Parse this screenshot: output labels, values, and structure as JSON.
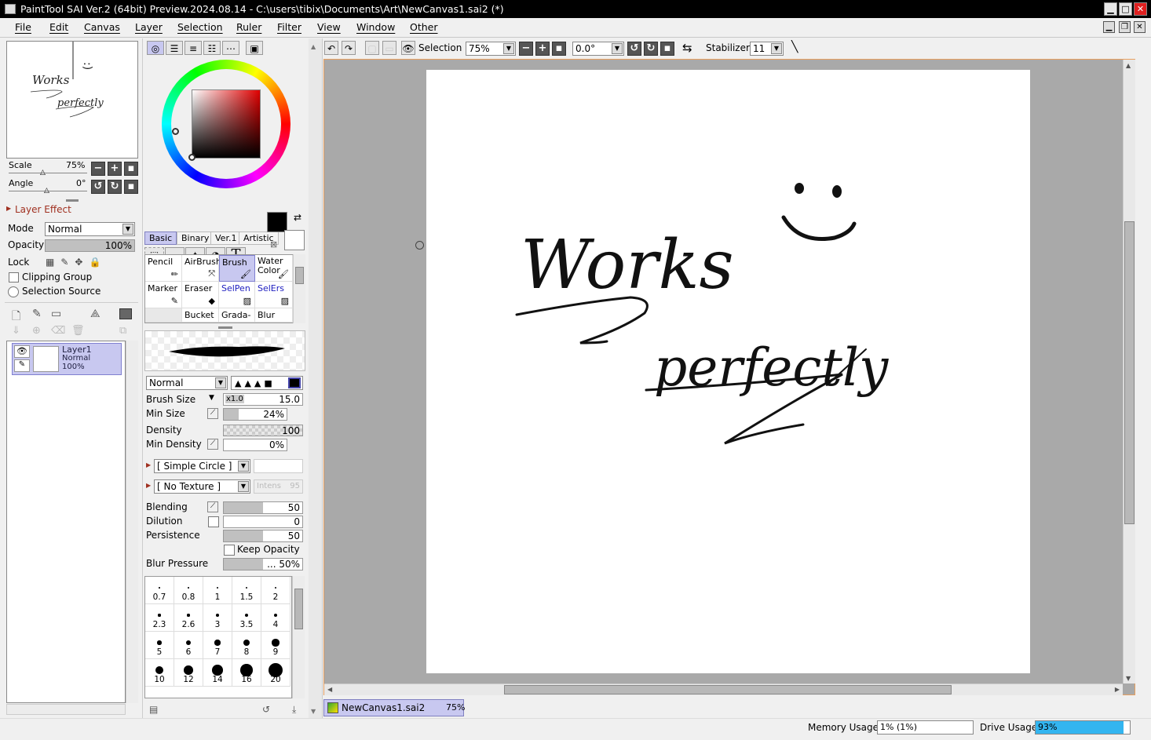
{
  "window": {
    "title": "PaintTool SAI Ver.2 (64bit) Preview.2024.08.14 - C:\\users\\tibix\\Documents\\Art\\NewCanvas1.sai2 (*)",
    "min": "▁",
    "max": "□",
    "close": "✕"
  },
  "menu": [
    "File",
    "Edit",
    "Canvas",
    "Layer",
    "Selection",
    "Ruler",
    "Filter",
    "View",
    "Window",
    "Other"
  ],
  "navigator": {
    "scale_label": "Scale",
    "scale_value": "75%",
    "angle_label": "Angle",
    "angle_value": "0°",
    "preview_text": [
      "Works",
      "perfectly",
      ":)"
    ]
  },
  "layer_effect": {
    "header": "Layer Effect",
    "mode_label": "Mode",
    "mode_value": "Normal",
    "opacity_label": "Opacity",
    "opacity_value": "100%",
    "lock_label": "Lock",
    "clipping_group": "Clipping Group",
    "selection_source": "Selection Source"
  },
  "layers": [
    {
      "name": "Layer1",
      "mode": "Normal",
      "opacity": "100%"
    }
  ],
  "color_tabs": {
    "basic": "Basic",
    "binary": "Binary",
    "ver1": "Ver.1",
    "artistic": "Artistic"
  },
  "tools": [
    {
      "label": "Pencil"
    },
    {
      "label": "AirBrush"
    },
    {
      "label": "Brush",
      "selected": true
    },
    {
      "label": "Water Color"
    },
    {
      "label": "Marker"
    },
    {
      "label": "Eraser"
    },
    {
      "label": "SelPen",
      "blue": true
    },
    {
      "label": "SelErs",
      "blue": true
    },
    {
      "label": ""
    },
    {
      "label": "Bucket"
    },
    {
      "label": "Grada-"
    },
    {
      "label": "Blur"
    }
  ],
  "brush": {
    "blend_mode": "Normal",
    "size_label": "Brush Size",
    "size_mult": "x1.0",
    "size_value": "15.0",
    "min_size_label": "Min Size",
    "min_size_value": "24%",
    "min_size_pct": 24,
    "density_label": "Density",
    "density_value": "100",
    "min_density_label": "Min Density",
    "min_density_value": "0%",
    "shape": "[ Simple Circle ]",
    "texture": "[ No Texture ]",
    "texture_intens": "Intens",
    "texture_intens_value": "95",
    "blending_label": "Blending",
    "blending_value": "50",
    "blending_pct": 50,
    "dilution_label": "Dilution",
    "dilution_value": "0",
    "persistence_label": "Persistence",
    "persistence_value": "50",
    "persistence_pct": 50,
    "keep_opacity": "Keep Opacity",
    "blur_label": "Blur Pressure",
    "blur_value": "... 50%",
    "blur_pct": 50
  },
  "brush_sizes": [
    "0.7",
    "0.8",
    "1",
    "1.5",
    "2",
    "2.3",
    "2.6",
    "3",
    "3.5",
    "4",
    "5",
    "6",
    "7",
    "8",
    "9",
    "10",
    "12",
    "14",
    "16",
    "20"
  ],
  "toolbar": {
    "selection_label": "Selection",
    "zoom_value": "75%",
    "rotation_value": "0.0°",
    "stabilizer_label": "Stabilizer",
    "stabilizer_value": "11"
  },
  "canvas_text": {
    "line1": "Works",
    "line2": "perfectly"
  },
  "doc_tab": {
    "name": "NewCanvas1.sai2",
    "zoom": "75%"
  },
  "status": {
    "memory_label": "Memory Usage",
    "memory_value": "1% (1%)",
    "drive_label": "Drive Usage",
    "drive_value": "93%",
    "drive_pct": 93
  },
  "colors": {
    "accent": "#c8c8f0",
    "primary_color": "#000000",
    "canvas_bg": "#a9a9a9",
    "drive_bar": "#33b5f0"
  }
}
